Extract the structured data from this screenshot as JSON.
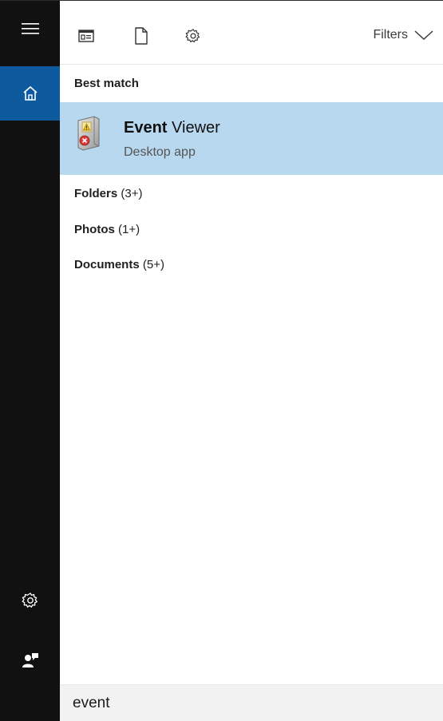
{
  "rail": {
    "items": [
      {
        "id": "menu",
        "icon": "hamburger-menu-icon"
      },
      {
        "id": "home",
        "icon": "home-icon",
        "active": true
      },
      {
        "id": "settings",
        "icon": "gear-icon"
      },
      {
        "id": "feedback",
        "icon": "feedback-person-icon"
      }
    ],
    "active_color": "#0d5a9e",
    "background": "#111111"
  },
  "toolbar": {
    "icons": [
      "apps-icon",
      "documents-icon",
      "settings-icon"
    ],
    "filters_label": "Filters"
  },
  "best_match": {
    "title": "Best match",
    "result": {
      "title_bold": "Event",
      "title_rest": " Viewer",
      "subtitle": "Desktop app",
      "icon": "event-viewer-icon",
      "highlight_color": "#b8d8f0"
    }
  },
  "categories": [
    {
      "label": "Folders",
      "count": "(3+)"
    },
    {
      "label": "Photos",
      "count": "(1+)"
    },
    {
      "label": "Documents",
      "count": "(5+)"
    }
  ],
  "search": {
    "value": "event"
  }
}
